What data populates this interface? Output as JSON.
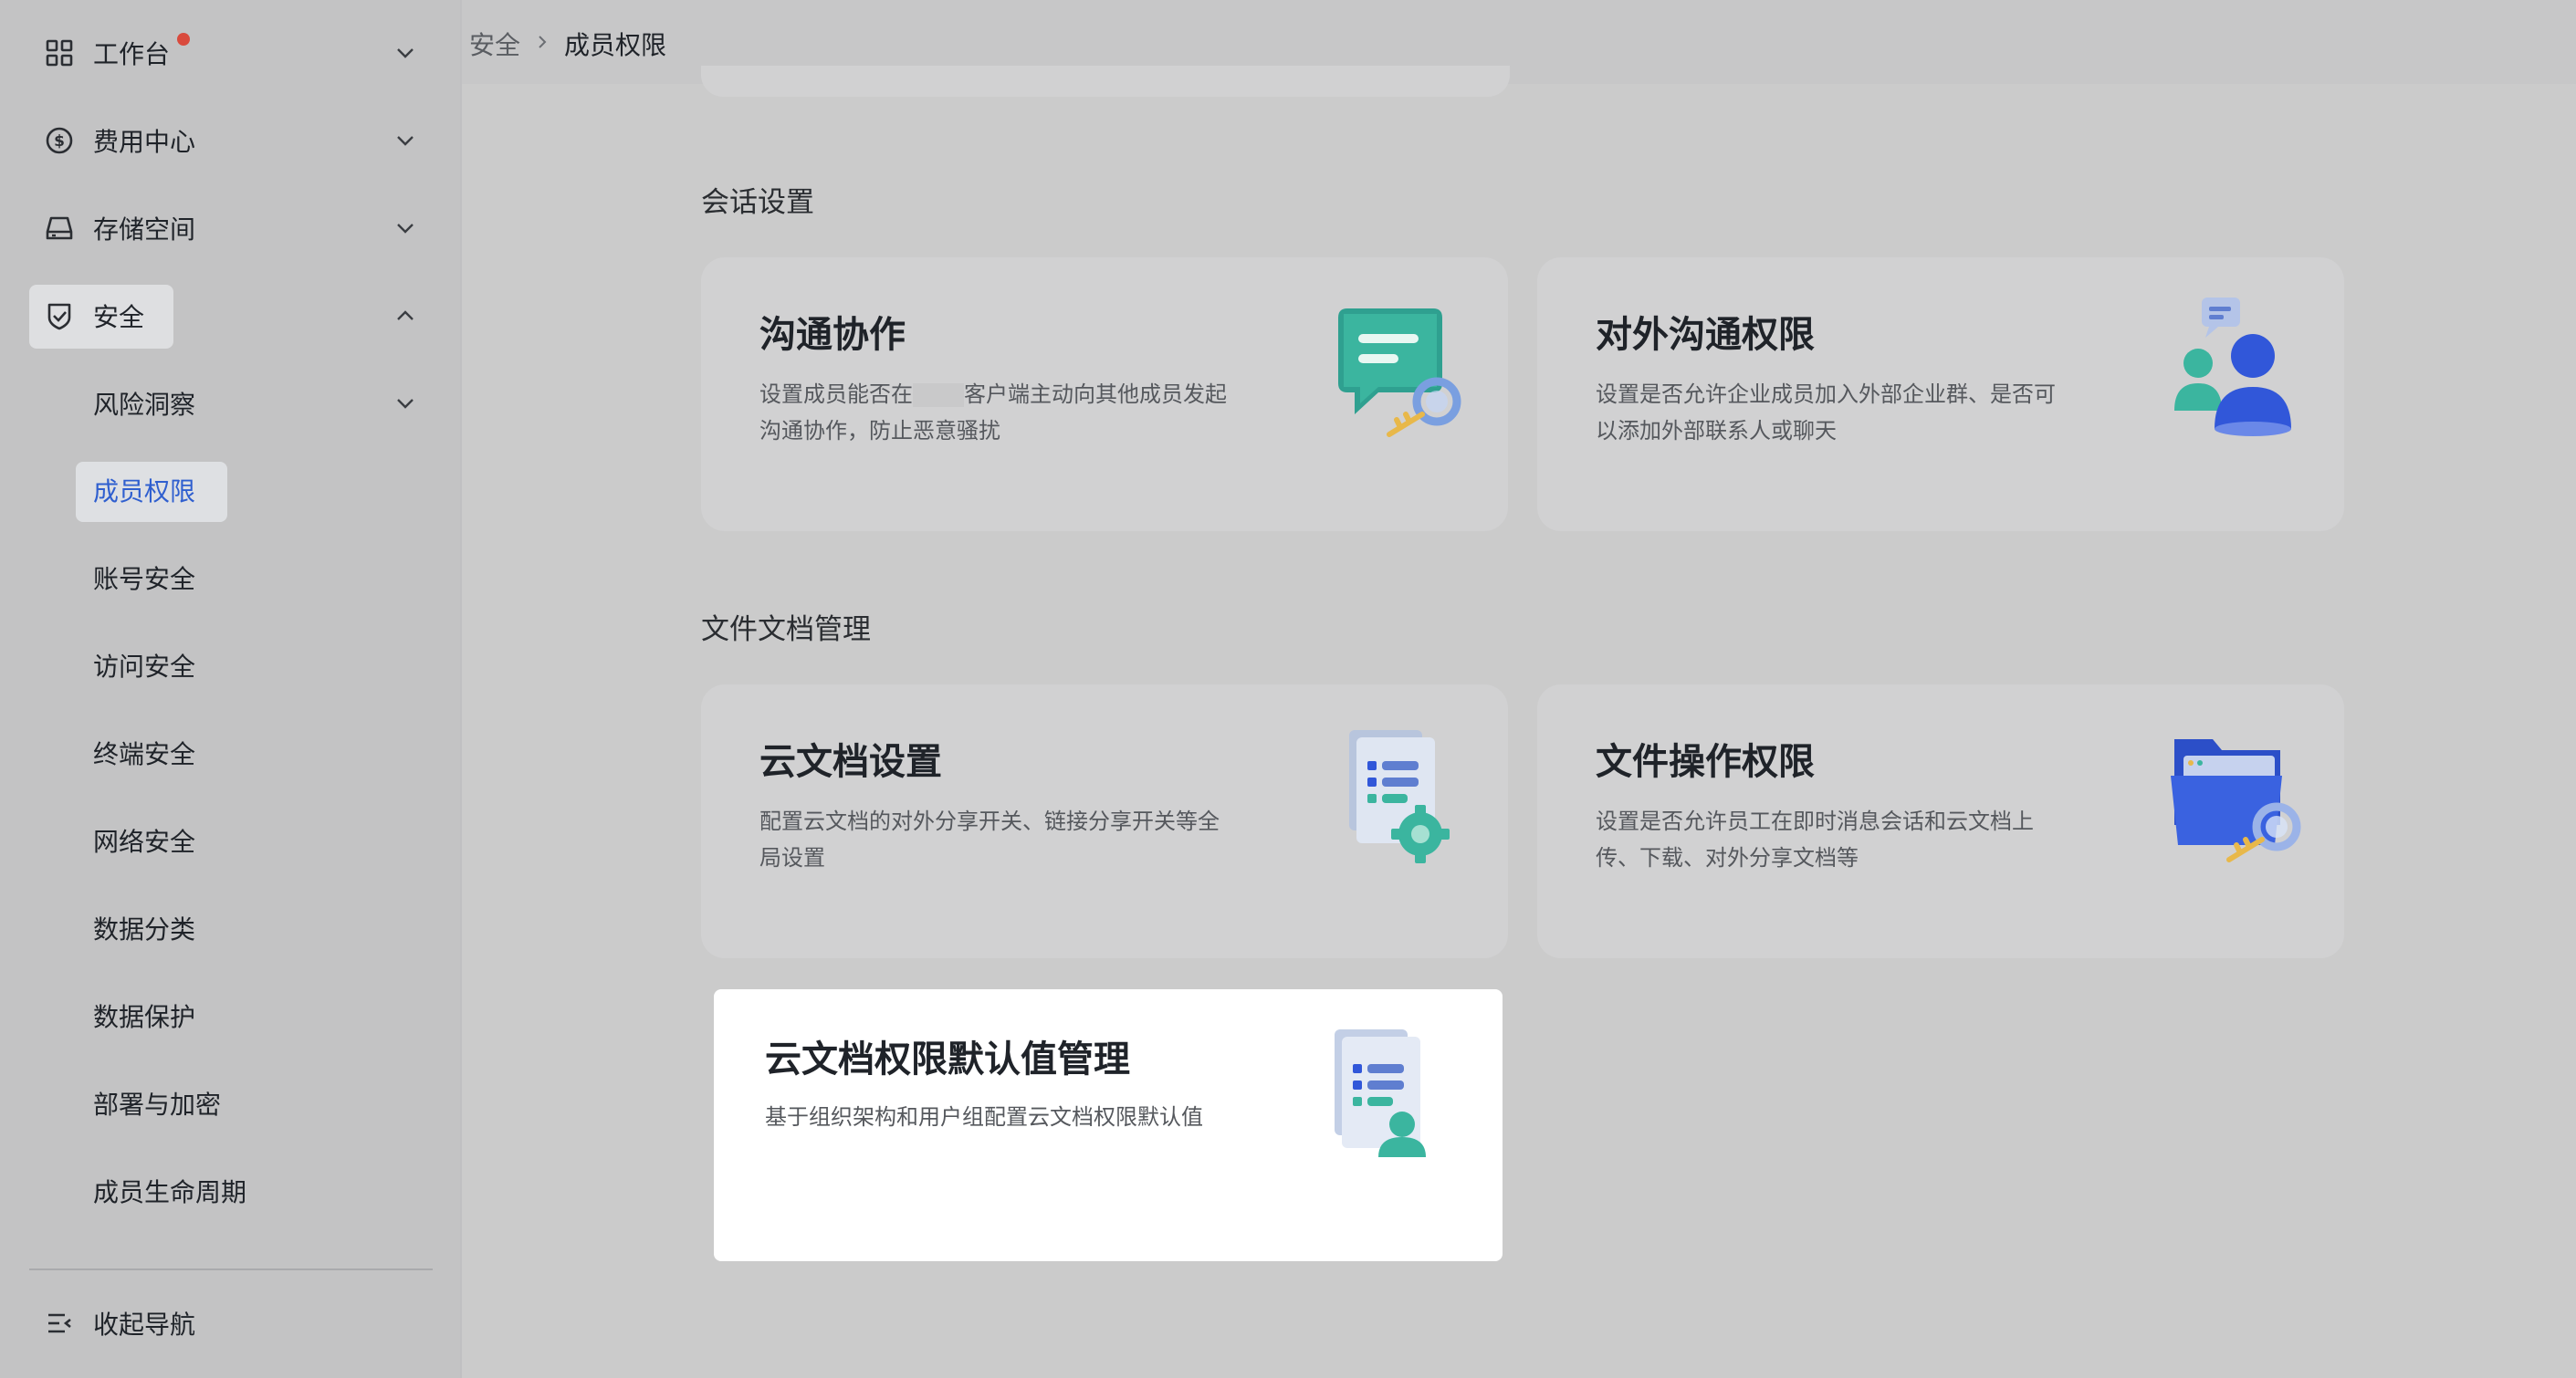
{
  "sidebar": {
    "items": [
      {
        "label": "工作台",
        "icon": "grid-icon",
        "expanded": false,
        "badge": true
      },
      {
        "label": "费用中心",
        "icon": "dollar-circle-icon",
        "expanded": false
      },
      {
        "label": "存储空间",
        "icon": "storage-drive-icon",
        "expanded": false
      },
      {
        "label": "安全",
        "icon": "shield-check-icon",
        "expanded": true
      }
    ],
    "security_subitems": [
      {
        "label": "风险洞察",
        "has_children": true
      },
      {
        "label": "成员权限",
        "active": true
      },
      {
        "label": "账号安全"
      },
      {
        "label": "访问安全"
      },
      {
        "label": "终端安全"
      },
      {
        "label": "网络安全"
      },
      {
        "label": "数据分类"
      },
      {
        "label": "数据保护"
      },
      {
        "label": "部署与加密"
      },
      {
        "label": "成员生命周期"
      }
    ],
    "collapse_label": "收起导航"
  },
  "breadcrumb": {
    "parent": "安全",
    "current": "成员权限"
  },
  "sections": [
    {
      "title": "会话设置",
      "cards": [
        {
          "title": "沟通协作",
          "desc_part1": "设置成员能否在",
          "desc_part2": "客户端主动向其他成员发起沟通协作，防止恶意骚扰",
          "icon": "chat-key-icon"
        },
        {
          "title": "对外沟通权限",
          "desc": "设置是否允许企业成员加入外部企业群、是否可以添加外部联系人或聊天",
          "icon": "people-chat-icon"
        }
      ]
    },
    {
      "title": "文件文档管理",
      "cards": [
        {
          "title": "云文档设置",
          "desc": "配置云文档的对外分享开关、链接分享开关等全局设置",
          "icon": "document-gear-icon"
        },
        {
          "title": "文件操作权限",
          "desc": "设置是否允许员工在即时消息会话和云文档上传、下载、对外分享文档等",
          "icon": "folder-key-icon"
        },
        {
          "title": "云文档权限默认值管理",
          "desc": "基于组织架构和用户组配置云文档权限默认值",
          "icon": "document-person-icon"
        }
      ]
    }
  ],
  "colors": {
    "accent": "#2f5fcf",
    "badge": "#d94a3d",
    "teal": "#3bb59f",
    "blue": "#3157d9"
  }
}
